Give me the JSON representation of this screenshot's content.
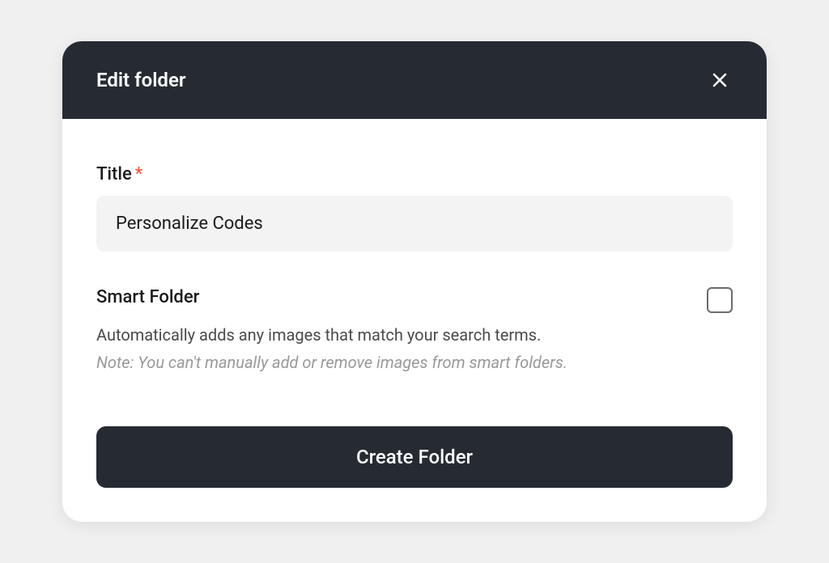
{
  "modal": {
    "title": "Edit folder",
    "title_field": {
      "label": "Title",
      "required_marker": "*",
      "value": "Personalize Codes"
    },
    "smart_folder": {
      "label": "Smart Folder",
      "description": "Automatically adds any images that match your search terms.",
      "note": "Note: You can't manually add or remove images from smart folders.",
      "checked": false
    },
    "submit_label": "Create Folder"
  }
}
